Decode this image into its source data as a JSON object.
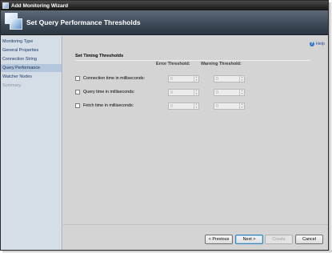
{
  "window": {
    "title": "Add Monitoring Wizard",
    "banner_title": "Set Query Performance Thresholds"
  },
  "nav": {
    "items": [
      {
        "label": "Monitoring Type",
        "state": "normal"
      },
      {
        "label": "General Properties",
        "state": "normal"
      },
      {
        "label": "Connection String",
        "state": "normal"
      },
      {
        "label": "Query Performance",
        "state": "active"
      },
      {
        "label": "Watcher Nodes",
        "state": "normal"
      },
      {
        "label": "Summary",
        "state": "disabled"
      }
    ]
  },
  "help": {
    "label": "Help"
  },
  "section": {
    "title": "Set Timing Thresholds",
    "error_header": "Error Threshold:",
    "warning_header": "Warning Threshold:"
  },
  "rows": [
    {
      "label": "Connection time in milliseconds:",
      "error_value": "0",
      "warning_value": "0",
      "checked": false
    },
    {
      "label": "Query time in milliseconds:",
      "error_value": "0",
      "warning_value": "0",
      "checked": false
    },
    {
      "label": "Fetch time in milliseconds:",
      "error_value": "0",
      "warning_value": "0",
      "checked": false
    }
  ],
  "footer": {
    "previous": "< Previous",
    "next": "Next >",
    "create": "Create",
    "cancel": "Cancel"
  }
}
